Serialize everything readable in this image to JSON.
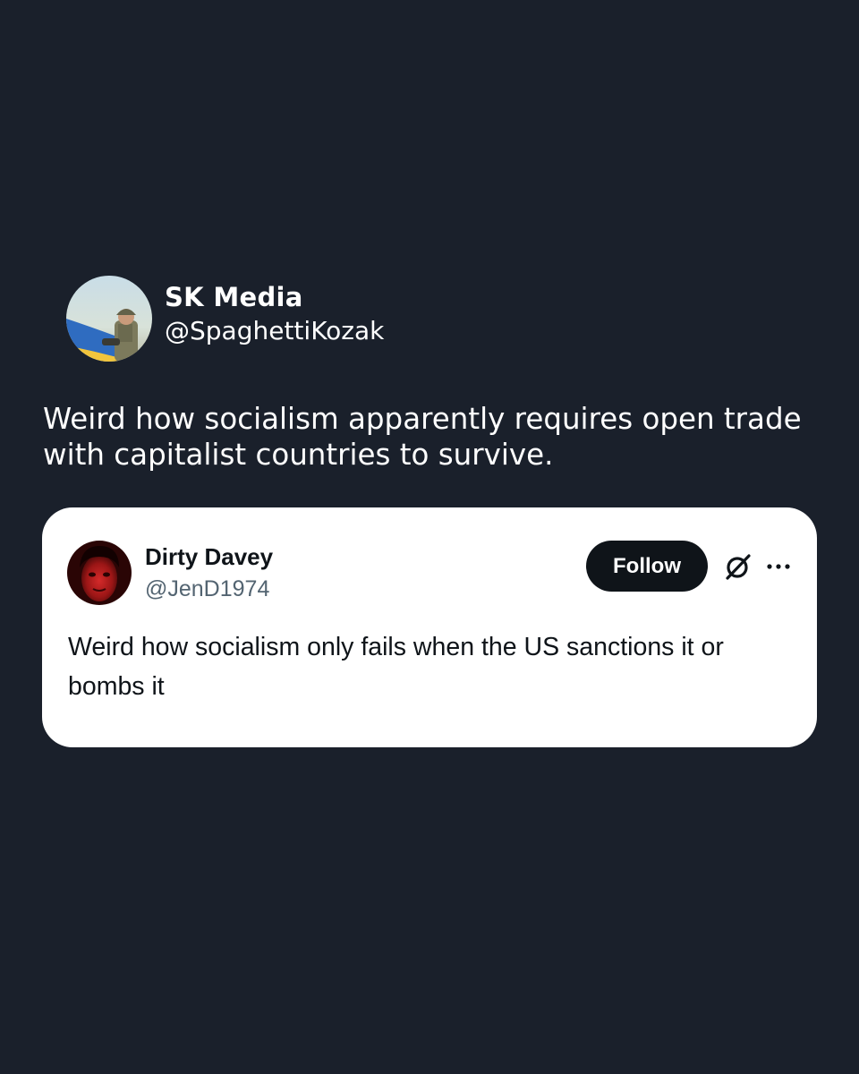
{
  "post": {
    "author_name": "SK Media",
    "author_handle": "@SpaghettiKozak",
    "text": "Weird how socialism apparently requires open trade with capitalist countries to survive.",
    "avatar_icon": "profile-photo-soldier-ukraine-flag"
  },
  "quoted_tweet": {
    "author_name": "Dirty Davey",
    "author_handle": "@JenD1974",
    "follow_label": "Follow",
    "text": "Weird how socialism only fails when the US sanctions it or bombs it",
    "avatar_icon": "profile-photo-red",
    "grok_icon": "grok-icon",
    "more_icon": "more-dots-icon"
  },
  "colors": {
    "background": "#1a202b",
    "card": "#ffffff",
    "primary_text": "#0f1419",
    "secondary_text": "#536471",
    "follow_button": "#0f1419"
  }
}
